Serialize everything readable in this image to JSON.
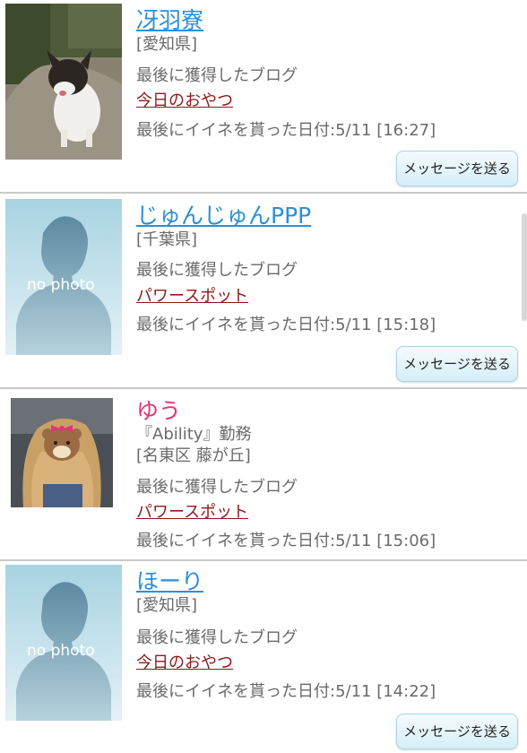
{
  "users": [
    {
      "name": "冴羽寮",
      "name_color": "#2b8fd6",
      "extra": "",
      "location": "[愛知県]",
      "blog_heading": "最後に獲得したブログ",
      "blog_title": "今日のおやつ",
      "last_like": "最後にイイネを貰った日付:5/11 [16:27]",
      "button_label": "メッセージを送る",
      "photo": "dog-photo"
    },
    {
      "name": "じゅんじゅんPPP",
      "name_color": "#2b8fd6",
      "extra": "",
      "location": "[千葉県]",
      "blog_heading": "最後に獲得したブログ",
      "blog_title": "パワースポット",
      "last_like": "最後にイイネを貰った日付:5/11 [15:18]",
      "button_label": "メッセージを送る",
      "photo": "no-photo",
      "photo_text": "no photo"
    },
    {
      "name": "ゆう",
      "name_color": "#e0357a",
      "extra": "『Ability』勤務",
      "location": "[名東区 藤が丘]",
      "blog_heading": "最後に獲得したブログ",
      "blog_title": "パワースポット",
      "last_like": "最後にイイネを貰った日付:5/11 [15:06]",
      "button_label": "",
      "photo": "woman-photo"
    },
    {
      "name": "ほーり",
      "name_color": "#2b8fd6",
      "extra": "",
      "location": "[愛知県]",
      "blog_heading": "最後に獲得したブログ",
      "blog_title": "今日のおやつ",
      "last_like": "最後にイイネを貰った日付:5/11 [14:22]",
      "button_label": "メッセージを送る",
      "photo": "no-photo",
      "photo_text": "no photo"
    }
  ]
}
